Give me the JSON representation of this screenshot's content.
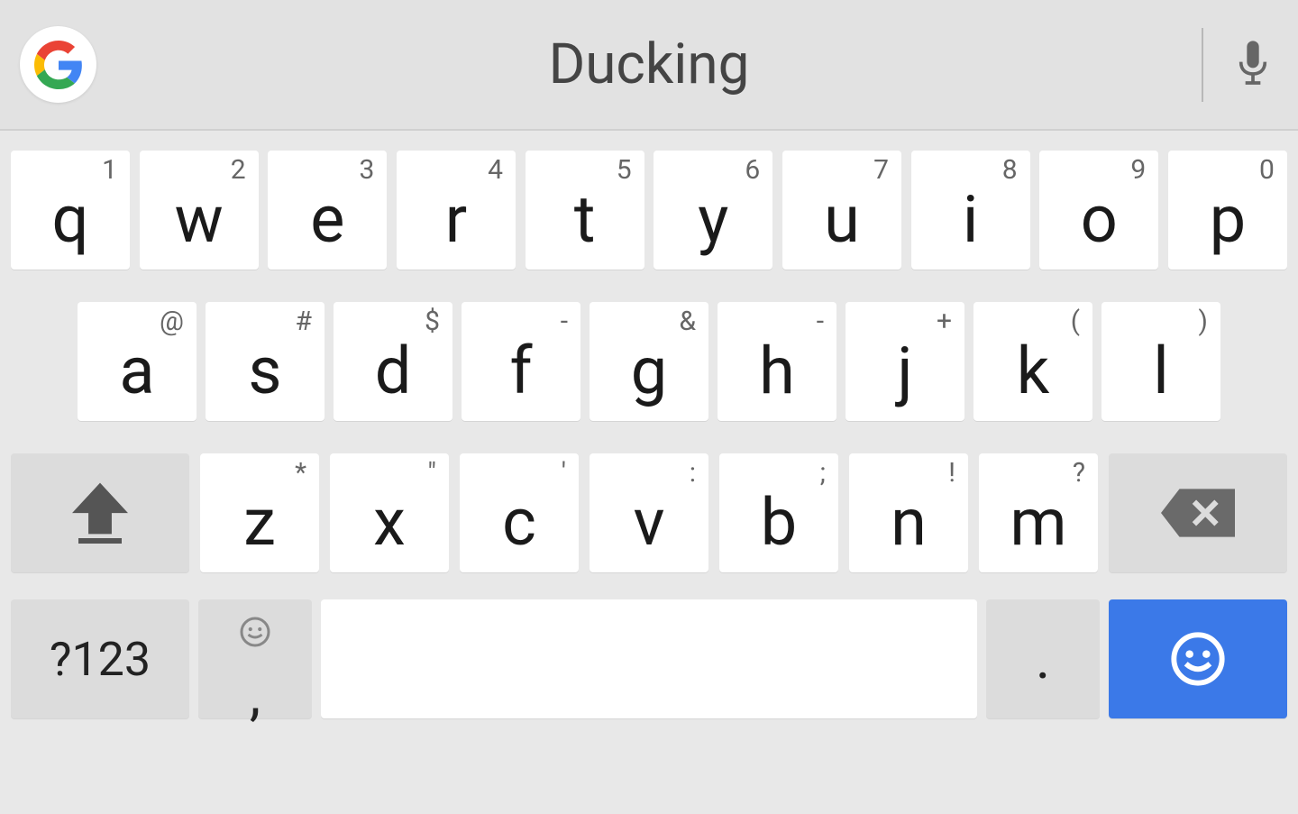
{
  "suggestion_bar": {
    "suggestion": "Ducking"
  },
  "keyboard": {
    "row1": [
      {
        "main": "q",
        "hint": "1"
      },
      {
        "main": "w",
        "hint": "2"
      },
      {
        "main": "e",
        "hint": "3"
      },
      {
        "main": "r",
        "hint": "4"
      },
      {
        "main": "t",
        "hint": "5"
      },
      {
        "main": "y",
        "hint": "6"
      },
      {
        "main": "u",
        "hint": "7"
      },
      {
        "main": "i",
        "hint": "8"
      },
      {
        "main": "o",
        "hint": "9"
      },
      {
        "main": "p",
        "hint": "0"
      }
    ],
    "row2": [
      {
        "main": "a",
        "hint": "@"
      },
      {
        "main": "s",
        "hint": "#"
      },
      {
        "main": "d",
        "hint": "$"
      },
      {
        "main": "f",
        "hint": "-"
      },
      {
        "main": "g",
        "hint": "&"
      },
      {
        "main": "h",
        "hint": "-"
      },
      {
        "main": "j",
        "hint": "+"
      },
      {
        "main": "k",
        "hint": "("
      },
      {
        "main": "l",
        "hint": ")"
      }
    ],
    "row3": [
      {
        "main": "z",
        "hint": "*"
      },
      {
        "main": "x",
        "hint": "\""
      },
      {
        "main": "c",
        "hint": "'"
      },
      {
        "main": "v",
        "hint": ":"
      },
      {
        "main": "b",
        "hint": ";"
      },
      {
        "main": "n",
        "hint": "!"
      },
      {
        "main": "m",
        "hint": "?"
      }
    ],
    "row4": {
      "symbols_label": "?123",
      "comma": ",",
      "period": "."
    }
  }
}
